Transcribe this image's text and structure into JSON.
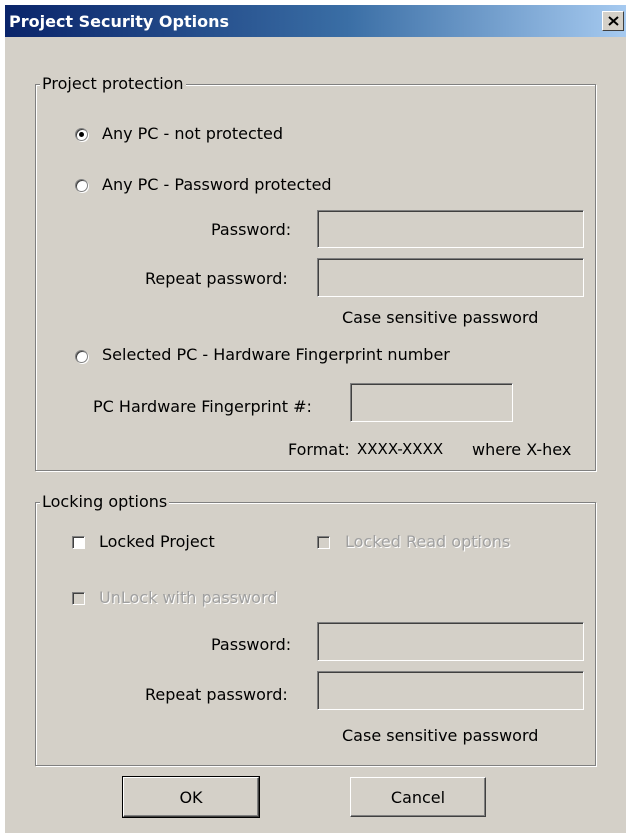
{
  "window": {
    "title": "Project Security Options",
    "close_glyph": "×"
  },
  "protection": {
    "legend": "Project protection",
    "options": [
      {
        "label": "Any PC - not protected",
        "checked": true
      },
      {
        "label": "Any PC - Password protected",
        "checked": false
      },
      {
        "label": "Selected PC - Hardware Fingerprint number",
        "checked": false
      }
    ],
    "password_label": "Password:",
    "password_value": "",
    "repeat_label": "Repeat password:",
    "repeat_value": "",
    "case_note": "Case sensitive password",
    "fingerprint_label": "PC Hardware Fingerprint #:",
    "fingerprint_value": "",
    "format_label": "Format:",
    "format_pattern": "XXXX-XXXX",
    "format_suffix": "where X-hex"
  },
  "locking": {
    "legend": "Locking options",
    "locked_project_label": "Locked Project",
    "locked_project_checked": false,
    "locked_read_label": "Locked Read options",
    "locked_read_checked": false,
    "unlock_label": "UnLock with password",
    "unlock_checked": false,
    "password_label": "Password:",
    "password_value": "",
    "repeat_label": "Repeat password:",
    "repeat_value": "",
    "case_note": "Case sensitive password"
  },
  "buttons": {
    "ok": "OK",
    "cancel": "Cancel"
  },
  "colors": {
    "title_start": "#0a246a",
    "title_end": "#a6caf0",
    "face": "#d4d0c8"
  }
}
